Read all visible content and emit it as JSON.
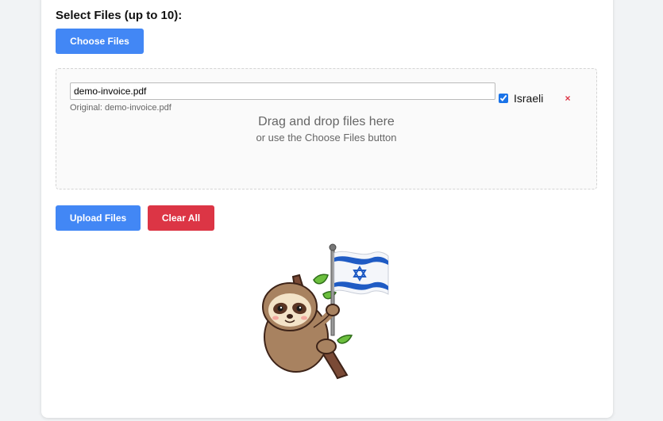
{
  "form": {
    "select_label": "Select Files (up to 10):",
    "choose_button": "Choose Files",
    "upload_button": "Upload Files",
    "clear_button": "Clear All"
  },
  "file": {
    "name_value": "demo-invoice.pdf",
    "original_label": "Original: demo-invoice.pdf",
    "tag_label": "Israeli",
    "tag_checked": true,
    "remove_symbol": "×"
  },
  "dropzone": {
    "title": "Drag and drop files here",
    "subtitle": "or use the Choose Files button"
  },
  "colors": {
    "primary": "#4287f5",
    "danger": "#dc3545",
    "flag_blue": "#1f5bc4"
  },
  "icons": {
    "mascot": "sloth-with-israeli-flag-illustration"
  }
}
